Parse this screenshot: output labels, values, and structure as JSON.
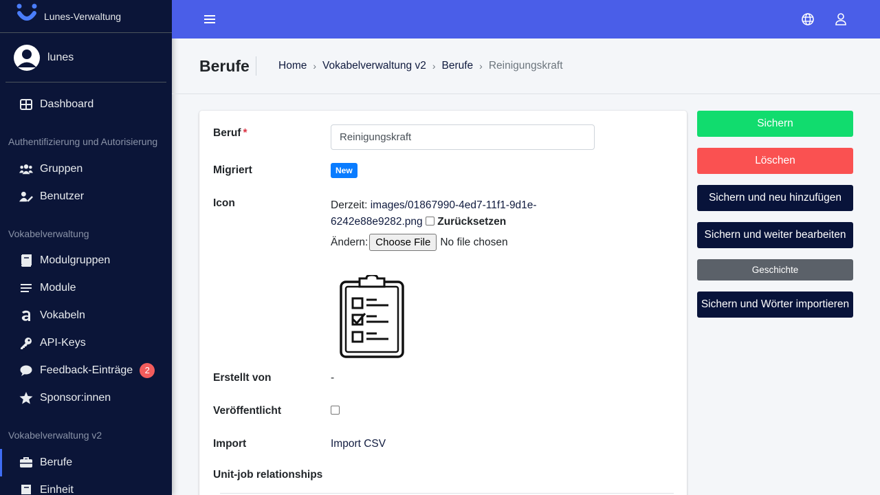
{
  "brand": {
    "title": "Lunes-Verwaltung"
  },
  "user": {
    "name": "lunes"
  },
  "sidebar": {
    "dashboard": "Dashboard",
    "section_auth": "Authentifizierung und Autorisierung",
    "gruppen": "Gruppen",
    "benutzer": "Benutzer",
    "section_vokabel": "Vokabelverwaltung",
    "modulgruppen": "Modulgruppen",
    "module": "Module",
    "vokabeln": "Vokabeln",
    "api_keys": "API-Keys",
    "feedback": "Feedback-Einträge",
    "feedback_count": "2",
    "sponsor": "Sponsor:innen",
    "section_vokabel_v2": "Vokabelverwaltung v2",
    "berufe": "Berufe",
    "einheit": "Einheit"
  },
  "header": {
    "title": "Berufe",
    "breadcrumb": [
      "Home",
      "Vokabelverwaltung v2",
      "Berufe",
      "Reinigungskraft"
    ],
    "separator": "›"
  },
  "form": {
    "beruf_label": "Beruf",
    "required_mark": "*",
    "beruf_value": "Reinigungskraft",
    "migriert_label": "Migriert",
    "migriert_badge": "New",
    "icon_label": "Icon",
    "icon_current_prefix": "Derzeit:",
    "icon_current_path_1": "images/01867990-4ed7-11f1-9d1e-",
    "icon_current_path_2": "6242e88e9282.png",
    "icon_reset": "Zurücksetzen",
    "icon_change": "Ändern:",
    "choose_file": "Choose File",
    "no_file": "No file chosen",
    "erstellt_label": "Erstellt von",
    "erstellt_value": "-",
    "veroeffentlicht_label": "Veröffentlicht",
    "import_label": "Import",
    "import_link": "Import CSV",
    "unit_job_label": "Unit-job relationships"
  },
  "actions": {
    "save": "Sichern",
    "delete": "Löschen",
    "save_add": "Sichern und neu hinzufügen",
    "save_continue": "Sichern und weiter bearbeiten",
    "history": "Geschichte",
    "save_import": "Sichern und Wörter importieren"
  },
  "colors": {
    "sidebar": "#0b1538",
    "topbar": "#4a5ee8",
    "save": "#11dc6e",
    "delete": "#fa5151",
    "dark_button": "#08133a",
    "history": "#5b6169",
    "badge_new": "#0a7cff"
  }
}
